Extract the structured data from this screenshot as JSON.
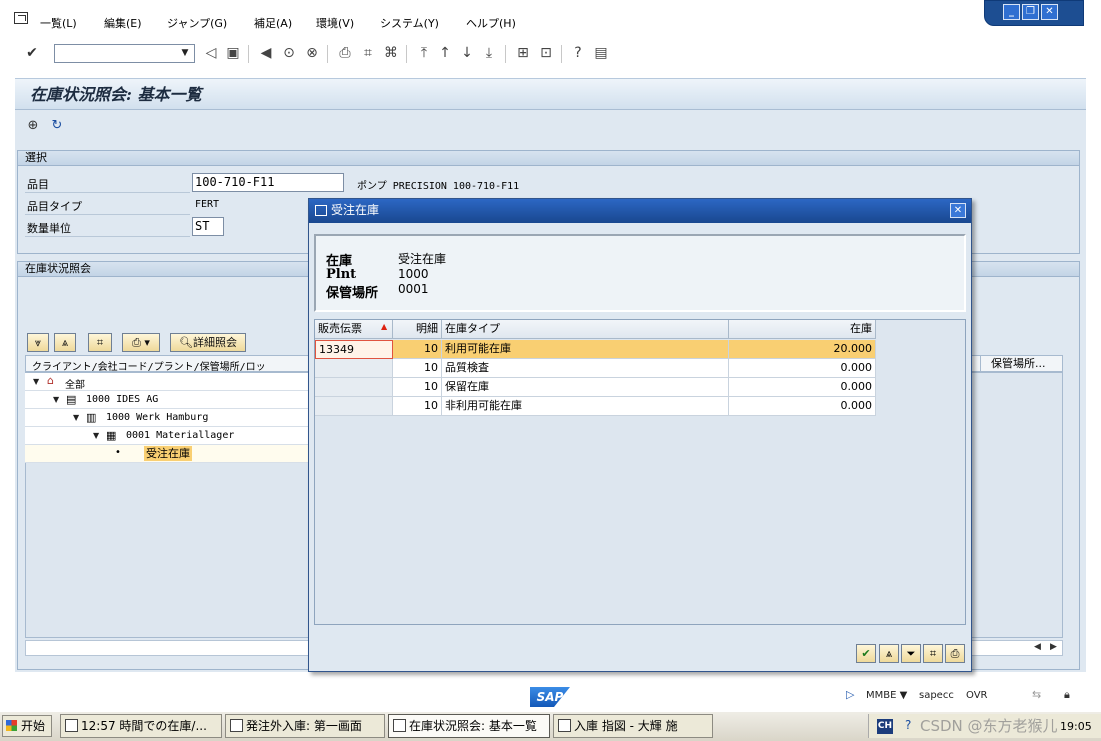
{
  "menubar": {
    "items": [
      "一覧(L)",
      "編集(E)",
      "ジャンプ(G)",
      "補足(A)",
      "環境(V)",
      "システム(Y)",
      "ヘルプ(H)"
    ]
  },
  "title": "在庫状況照会: 基本一覧",
  "selection": {
    "group_title": "選択",
    "material_label": "品目",
    "material_value": "100-710-F11",
    "material_desc": "ポンプ PRECISION 100-710-F11",
    "material_type_label": "品目タイプ",
    "material_type_value": "FERT",
    "unit_label": "数量単位",
    "unit_value": "ST"
  },
  "overview": {
    "group_title": "在庫状況照会",
    "detail_button": "詳細照会",
    "column_header": "クライアント/会社コード/プラント/保管場所/ロッ",
    "right_column_header": "保管場所...",
    "tree": [
      {
        "label": "全部"
      },
      {
        "label": "1000 IDES AG"
      },
      {
        "label": "1000 Werk Hamburg"
      },
      {
        "label": "0001 Materiallager"
      },
      {
        "label": "受注在庫"
      }
    ]
  },
  "dialog": {
    "title": "受注在庫",
    "header": {
      "stock_label": "在庫",
      "stock_value": "受注在庫",
      "plant_label": "Plnt",
      "plant_value": "1000",
      "sloc_label": "保管場所",
      "sloc_value": "0001"
    },
    "columns": [
      "販売伝票",
      "明細",
      "在庫タイプ",
      "在庫"
    ],
    "rows": [
      {
        "doc": "13349",
        "item": "10",
        "type": "利用可能在庫",
        "stock": "20.000"
      },
      {
        "doc": "",
        "item": "10",
        "type": "品質検査",
        "stock": "0.000"
      },
      {
        "doc": "",
        "item": "10",
        "type": "保留在庫",
        "stock": "0.000"
      },
      {
        "doc": "",
        "item": "10",
        "type": "非利用可能在庫",
        "stock": "0.000"
      }
    ]
  },
  "status": {
    "logo": "SAP",
    "transaction": "MMBE",
    "server": "sapecc",
    "mode": "OVR"
  },
  "taskbar": {
    "start": "开始",
    "tasks": [
      "12:57 時間での在庫/...",
      "発注外入庫: 第一画面",
      "在庫状況照会: 基本一覧",
      "入庫 指図 - 大輝 施"
    ],
    "lang": "CH",
    "watermark": "CSDN @东方老猴儿",
    "clock": "19:05"
  },
  "colors": {
    "accent": "#19478f",
    "selected_row": "#f9cf72",
    "panel": "#dfe8f1"
  }
}
